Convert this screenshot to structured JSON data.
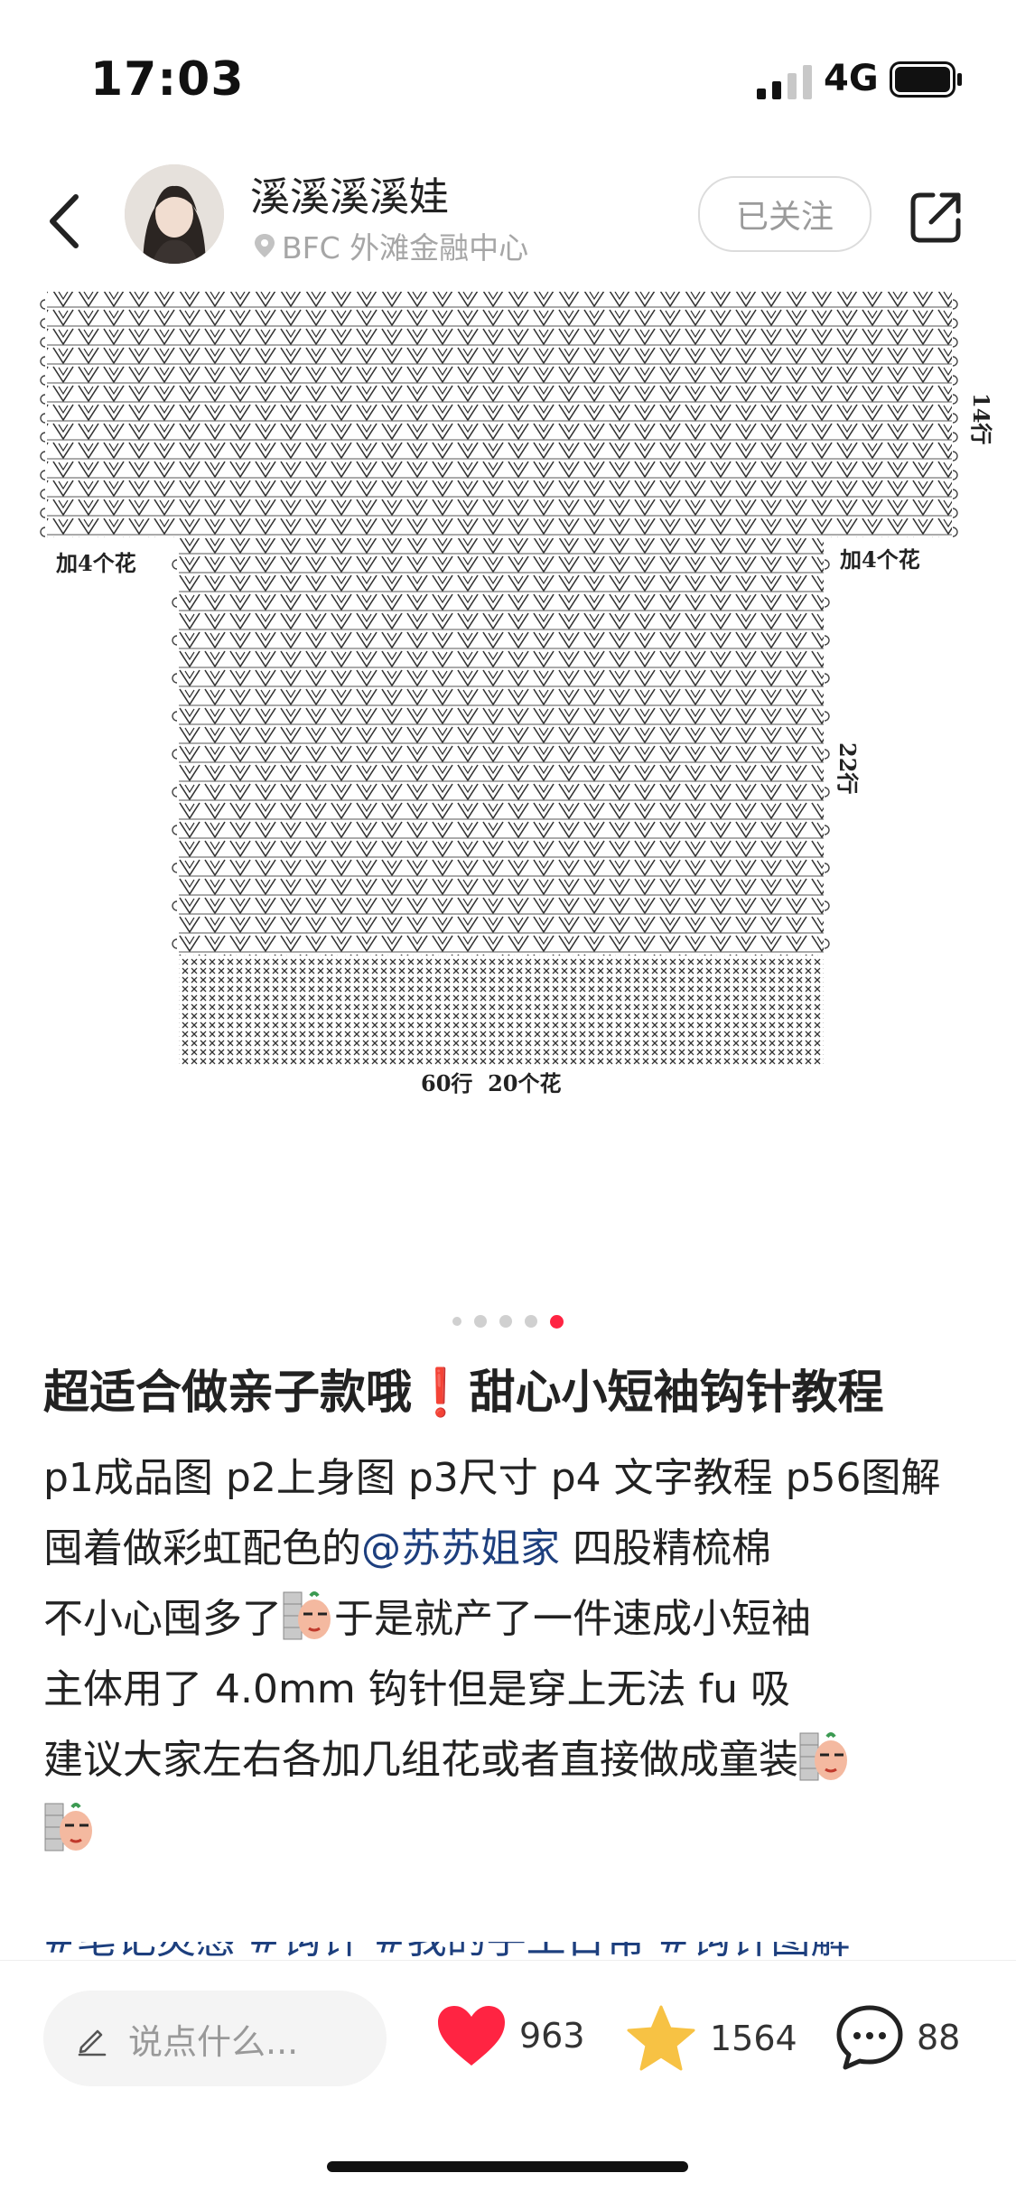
{
  "status": {
    "time": "17:03",
    "network": "4G"
  },
  "header": {
    "username": "溪溪溪溪娃",
    "location": "BFC 外滩金融中心",
    "follow_label": "已关注"
  },
  "pattern": {
    "label_rows_top": "14行",
    "label_left": "加4个花",
    "label_right": "加4个花",
    "label_rows_mid": "22行",
    "label_bottom": "60行  20个花"
  },
  "carousel": {
    "count": 5,
    "active": 5
  },
  "post": {
    "title": "超适合做亲子款哦❗甜心小短袖钩针教程",
    "line1": "p1成品图 p2上身图 p3尺寸 p4 文字教程 p56图解",
    "line2_prefix": "囤着做彩虹配色的",
    "line2_mention": "@苏苏姐家",
    "line2_suffix": " 四股精梳棉",
    "line3_prefix": "不小心囤多了",
    "line3_suffix": "于是就产了一件速成小短袖",
    "line4": "主体用了 4.0mm 钩针但是穿上无法 fu 吸",
    "line5": "建议大家左右各加几组花或者直接做成童装",
    "tags": "#笔记灵感  #钩针  #我的手工日常  #钩针图解"
  },
  "bottom": {
    "comment_placeholder": "说点什么...",
    "likes": "963",
    "collects": "1564",
    "comments": "88"
  },
  "colors": {
    "accent": "#ff2442",
    "mention": "#1d3f7e",
    "star": "#f7c244"
  }
}
